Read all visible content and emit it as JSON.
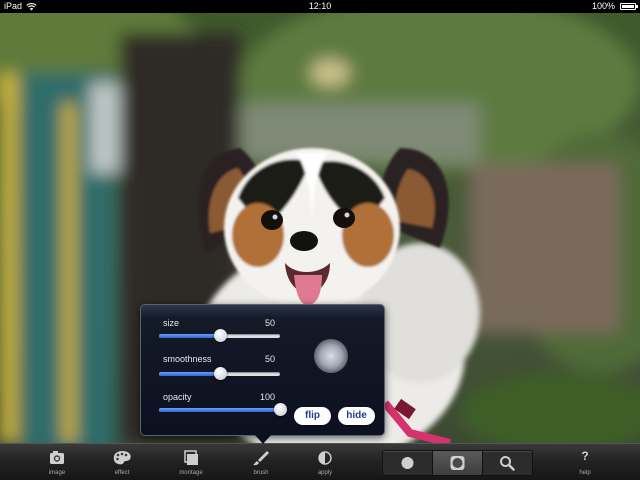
{
  "status_bar": {
    "device": "iPad",
    "time": "12:10",
    "battery": "100%",
    "battery_level": 1.0
  },
  "brush_panel": {
    "size": {
      "label": "size",
      "value": "50",
      "fraction": 0.5
    },
    "smoothness": {
      "label": "smoothness",
      "value": "50",
      "fraction": 0.5
    },
    "opacity": {
      "label": "opacity",
      "value": "100",
      "fraction": 1.0
    },
    "flip_label": "flip",
    "hide_label": "hide"
  },
  "toolbar": {
    "image": {
      "label": "image",
      "icon": "camera-icon"
    },
    "effect": {
      "label": "effect",
      "icon": "palette-icon"
    },
    "montage": {
      "label": "montage",
      "icon": "montage-icon"
    },
    "brush": {
      "label": "brush",
      "icon": "brush-icon"
    },
    "apply": {
      "label": "apply",
      "icon": "half-circle-icon"
    },
    "help": {
      "label": "help",
      "icon": "question-mark-icon",
      "glyph": "?"
    },
    "segments": [
      {
        "icon": "circle-icon",
        "selected": false
      },
      {
        "icon": "square-circle-icon",
        "selected": true
      },
      {
        "icon": "magnifier-icon",
        "selected": false
      }
    ]
  },
  "colors": {
    "accent": "#2f63d6",
    "panel": "#0c1020",
    "pill_text": "#1f3f86",
    "leash": "#d8326e"
  }
}
